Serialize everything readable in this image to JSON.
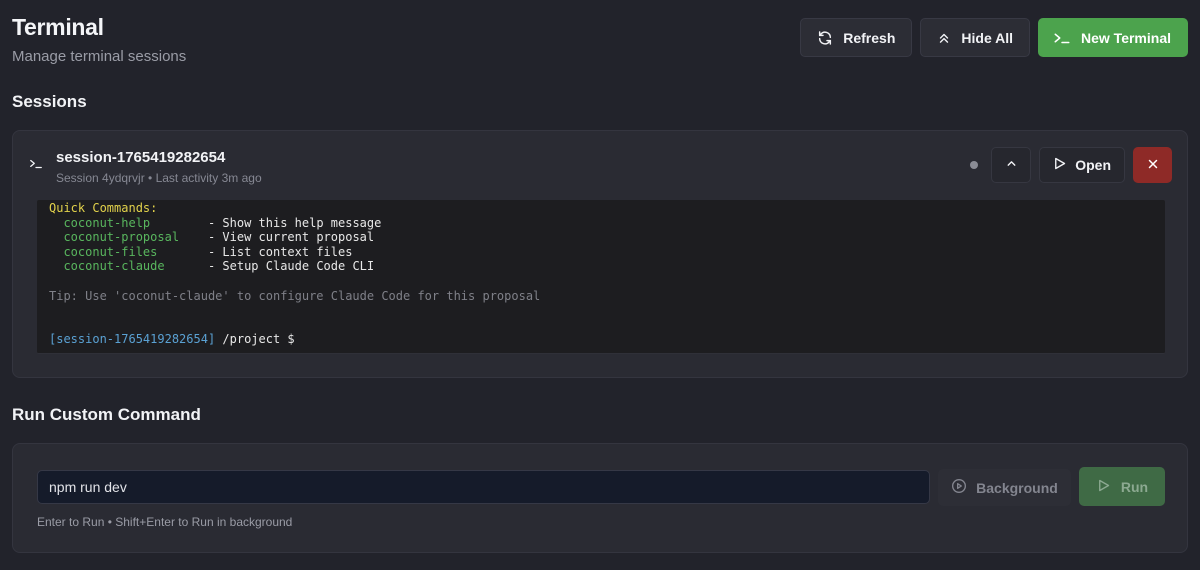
{
  "header": {
    "title": "Terminal",
    "subtitle": "Manage terminal sessions"
  },
  "toolbar": {
    "refresh_label": "Refresh",
    "hide_all_label": "Hide All",
    "new_terminal_label": "New Terminal"
  },
  "sessions": {
    "title": "Sessions",
    "items": [
      {
        "name": "session-1765419282654",
        "meta": "Session 4ydqrvjr • Last activity 3m ago",
        "open_label": "Open",
        "terminal": {
          "heading": "Quick Commands:",
          "commands": [
            {
              "cmd": "  coconut-help        ",
              "desc": "- Show this help message"
            },
            {
              "cmd": "  coconut-proposal    ",
              "desc": "- View current proposal"
            },
            {
              "cmd": "  coconut-files       ",
              "desc": "- List context files"
            },
            {
              "cmd": "  coconut-claude      ",
              "desc": "- Setup Claude Code CLI"
            }
          ],
          "tip": "Tip: Use 'coconut-claude' to configure Claude Code for this proposal",
          "prompt_session": "[session-1765419282654]",
          "prompt_path": " /project $"
        }
      }
    ]
  },
  "custom_command": {
    "title": "Run Custom Command",
    "input_value": "npm run dev",
    "background_label": "Background",
    "run_label": "Run",
    "hint": "Enter to Run • Shift+Enter to Run in background"
  },
  "colors": {
    "background": "#22232b",
    "card": "#2a2b33",
    "accent_green": "#4ca34d",
    "danger": "#8e2a27",
    "terminal_bg": "#1d1d20"
  },
  "icons": {
    "refresh": "refresh-icon",
    "hide_all": "chevrons-up-icon",
    "new_terminal": "terminal-prompt-icon",
    "collapse": "chevron-up-icon",
    "open": "play-icon",
    "close": "close-icon",
    "background": "play-circle-icon",
    "run": "play-icon"
  }
}
